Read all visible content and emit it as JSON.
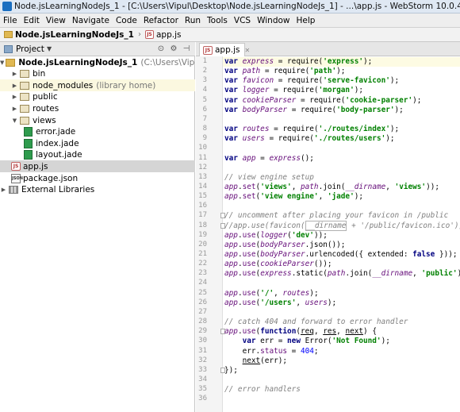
{
  "window": {
    "title": "Node.jsLearningNodeJs_1 - [C:\\Users\\Vipul\\Desktop\\Node.jsLearningNodeJs_1] - ...\\app.js - WebStorm 10.0.4"
  },
  "menu": [
    "File",
    "Edit",
    "View",
    "Navigate",
    "Code",
    "Refactor",
    "Run",
    "Tools",
    "VCS",
    "Window",
    "Help"
  ],
  "breadcrumb": {
    "project": "Node.jsLearningNodeJs_1",
    "file": "app.js"
  },
  "project_panel": {
    "label": "Project",
    "root": {
      "name": "Node.jsLearningNodeJs_1",
      "path": "(C:\\Users\\Vipul\\Desktop\\Nod"
    },
    "items": [
      {
        "name": "bin",
        "type": "folder",
        "depth": 1,
        "expanded": false
      },
      {
        "name": "node_modules",
        "note": "(library home)",
        "type": "folder",
        "depth": 1,
        "expanded": false
      },
      {
        "name": "public",
        "type": "folder",
        "depth": 1,
        "expanded": false
      },
      {
        "name": "routes",
        "type": "folder",
        "depth": 1,
        "expanded": false
      },
      {
        "name": "views",
        "type": "folder",
        "depth": 1,
        "expanded": true
      },
      {
        "name": "error.jade",
        "type": "jade",
        "depth": 2
      },
      {
        "name": "index.jade",
        "type": "jade",
        "depth": 2
      },
      {
        "name": "layout.jade",
        "type": "jade",
        "depth": 2
      },
      {
        "name": "app.js",
        "type": "js",
        "depth": 1,
        "selected": true
      },
      {
        "name": "package.json",
        "type": "json",
        "depth": 1
      }
    ],
    "external": "External Libraries"
  },
  "editor": {
    "tab": "app.js",
    "current_line": 1,
    "lines": [
      {
        "n": "1",
        "html": "<span class=\"kw\">var</span> <span class=\"v\">express</span> = require(<span class=\"str\">'express'</span>);"
      },
      {
        "n": "2",
        "html": "<span class=\"kw\">var</span> <span class=\"v\">path</span> = require(<span class=\"str\">'path'</span>);"
      },
      {
        "n": "3",
        "html": "<span class=\"kw\">var</span> <span class=\"v\">favicon</span> = require(<span class=\"str\">'serve-favicon'</span>);"
      },
      {
        "n": "4",
        "html": "<span class=\"kw\">var</span> <span class=\"v\">logger</span> = require(<span class=\"str\">'morgan'</span>);"
      },
      {
        "n": "5",
        "html": "<span class=\"kw\">var</span> <span class=\"v\">cookieParser</span> = require(<span class=\"str\">'cookie-parser'</span>);"
      },
      {
        "n": "6",
        "html": "<span class=\"kw\">var</span> <span class=\"v\">bodyParser</span> = require(<span class=\"str\">'body-parser'</span>);"
      },
      {
        "n": "7",
        "html": ""
      },
      {
        "n": "8",
        "html": "<span class=\"kw\">var</span> <span class=\"v\">routes</span> = require(<span class=\"str\">'./routes/index'</span>);"
      },
      {
        "n": "9",
        "html": "<span class=\"kw\">var</span> <span class=\"v\">users</span> = require(<span class=\"str\">'./routes/users'</span>);"
      },
      {
        "n": "10",
        "html": ""
      },
      {
        "n": "11",
        "html": "<span class=\"kw\">var</span> <span class=\"v\">app</span> = <span class=\"v\">express</span>();"
      },
      {
        "n": "12",
        "html": ""
      },
      {
        "n": "13",
        "html": "<span class=\"cmt\">// view engine setup</span>"
      },
      {
        "n": "14",
        "html": "<span class=\"v\">app</span>.<span class=\"m\">set</span>(<span class=\"str\">'views'</span>, <span class=\"v\">path</span>.join(<span class=\"v\">__dirname</span>, <span class=\"str\">'views'</span>));"
      },
      {
        "n": "15",
        "html": "<span class=\"v\">app</span>.<span class=\"m\">set</span>(<span class=\"str\">'view engine'</span>, <span class=\"str\">'jade'</span>);"
      },
      {
        "n": "16",
        "html": ""
      },
      {
        "n": "17",
        "html": "<span class=\"cmt\">// uncomment after placing your favicon in /public</span>"
      },
      {
        "n": "18",
        "html": "<span class=\"cmt\">//app.use(favicon(<span class=\"hl-box\">__dirname</span> + '/public/favicon.ico'));</span>"
      },
      {
        "n": "19",
        "html": "<span class=\"v\">app</span>.<span class=\"m\">use</span>(<span class=\"v\">logger</span>(<span class=\"str\">'dev'</span>));"
      },
      {
        "n": "20",
        "html": "<span class=\"v\">app</span>.<span class=\"m\">use</span>(<span class=\"v\">bodyParser</span>.json());"
      },
      {
        "n": "21",
        "html": "<span class=\"v\">app</span>.<span class=\"m\">use</span>(<span class=\"v\">bodyParser</span>.urlencoded({ extended: <span class=\"kw\">false</span> }));"
      },
      {
        "n": "22",
        "html": "<span class=\"v\">app</span>.<span class=\"m\">use</span>(<span class=\"v\">cookieParser</span>());"
      },
      {
        "n": "23",
        "html": "<span class=\"v\">app</span>.<span class=\"m\">use</span>(<span class=\"v\">express</span>.static(<span class=\"v\">path</span>.join(<span class=\"v\">__dirname</span>, <span class=\"str\">'public'</span>)));"
      },
      {
        "n": "24",
        "html": ""
      },
      {
        "n": "25",
        "html": "<span class=\"v\">app</span>.<span class=\"m\">use</span>(<span class=\"str\">'/'</span>, <span class=\"v\">routes</span>);"
      },
      {
        "n": "26",
        "html": "<span class=\"v\">app</span>.<span class=\"m\">use</span>(<span class=\"str\">'/users'</span>, <span class=\"v\">users</span>);"
      },
      {
        "n": "27",
        "html": ""
      },
      {
        "n": "28",
        "html": "<span class=\"cmt\">// catch 404 and forward to error handler</span>"
      },
      {
        "n": "29",
        "html": "<span class=\"v\">app</span>.<span class=\"m\">use</span>(<span class=\"kw\">function</span>(<span class=\"prm\">req</span>, <span class=\"prm\">res</span>, <span class=\"prm\">next</span>) {"
      },
      {
        "n": "30",
        "html": "    <span class=\"kw\">var</span> err = <span class=\"kw\">new</span> Error(<span class=\"str\">'Not Found'</span>);"
      },
      {
        "n": "31",
        "html": "    err.<span class=\"m\">status</span> = <span class=\"num\">404</span>;"
      },
      {
        "n": "32",
        "html": "    <span class=\"prm\">next</span>(err);"
      },
      {
        "n": "33",
        "html": "});"
      },
      {
        "n": "34",
        "html": ""
      },
      {
        "n": "35",
        "html": "<span class=\"cmt\">// error handlers</span>"
      },
      {
        "n": "36",
        "html": ""
      }
    ],
    "fold_lines": [
      "17",
      "18",
      "29",
      "33"
    ]
  }
}
